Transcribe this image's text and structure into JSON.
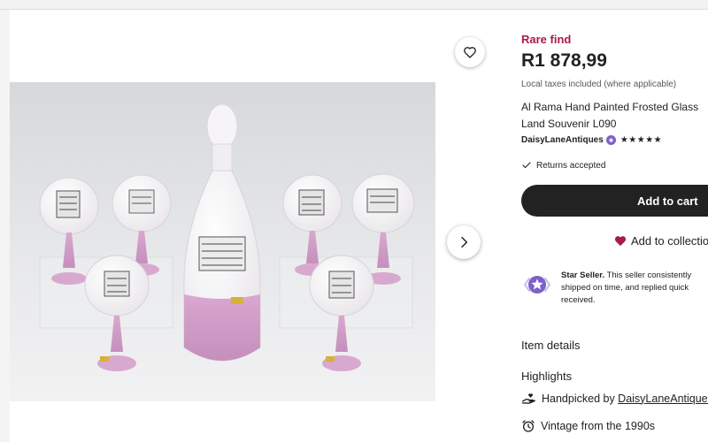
{
  "listing": {
    "rare_label": "Rare find",
    "price": "R1 878,99",
    "taxes_note": "Local taxes included (where applicable)",
    "title_line1": "Al Rama Hand Painted Frosted Glass",
    "title_line2": "Land Souvenir L090"
  },
  "shop": {
    "name": "DaisyLaneAntiques",
    "stars": "★★★★★",
    "returns": "Returns accepted"
  },
  "actions": {
    "add_to_cart": "Add to cart",
    "add_to_collection": "Add to collection"
  },
  "seller": {
    "badge_label": "Star Seller.",
    "line1_rest": " This seller consistently",
    "line2": "shipped on time, and replied quick",
    "line3": "received."
  },
  "details": {
    "item_details_label": "Item details",
    "highlights_label": "Highlights",
    "handpicked_prefix": "Handpicked by ",
    "handpicked_shop": "DaisyLaneAntiques",
    "vintage": "Vintage from the 1990s"
  },
  "icons": {
    "favorite": "heart-outline-icon",
    "next": "chevron-right-icon",
    "returns": "checkmark-icon",
    "collection": "heart-filled-icon",
    "star_seller": "star-seller-icon",
    "handpicked": "hand-heart-icon",
    "vintage": "alarm-clock-icon"
  },
  "colors": {
    "rare": "#a61a4f",
    "cart_button": "#222222",
    "collection_heart": "#a61a4f",
    "star_seller": "#7b61c9"
  }
}
